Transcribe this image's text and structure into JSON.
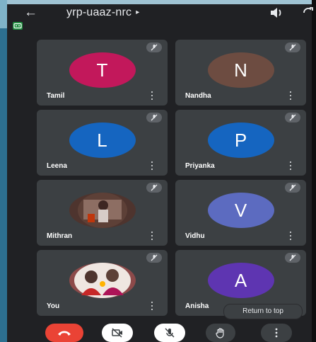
{
  "meeting": {
    "title": "yrp-uaaz-nrc",
    "title_caret": "▸"
  },
  "topbar": {
    "back_icon": "←"
  },
  "participants": [
    {
      "name": "Tamil",
      "initial": "T",
      "color": "#c2185b",
      "muted": true,
      "photo": false
    },
    {
      "name": "Nandha",
      "initial": "N",
      "color": "#6d4c41",
      "muted": true,
      "photo": false
    },
    {
      "name": "Leena",
      "initial": "L",
      "color": "#1565c0",
      "muted": true,
      "photo": false
    },
    {
      "name": "Priyanka",
      "initial": "P",
      "color": "#1565c0",
      "muted": true,
      "photo": false
    },
    {
      "name": "Mithran",
      "initial": "",
      "color": "#4e342e",
      "muted": true,
      "photo": true
    },
    {
      "name": "Vidhu",
      "initial": "V",
      "color": "#5c6bc0",
      "muted": true,
      "photo": false
    },
    {
      "name": "You",
      "initial": "",
      "color": "#8d4a4a",
      "muted": true,
      "photo": true
    },
    {
      "name": "Anisha",
      "initial": "A",
      "color": "#5e35b1",
      "muted": true,
      "photo": false
    }
  ],
  "return_to_top": "Return to top",
  "controls": {
    "end_call": "end-call",
    "camera": "camera-off",
    "microphone": "mic-off",
    "raise_hand": "raise-hand",
    "more": "more-options"
  }
}
